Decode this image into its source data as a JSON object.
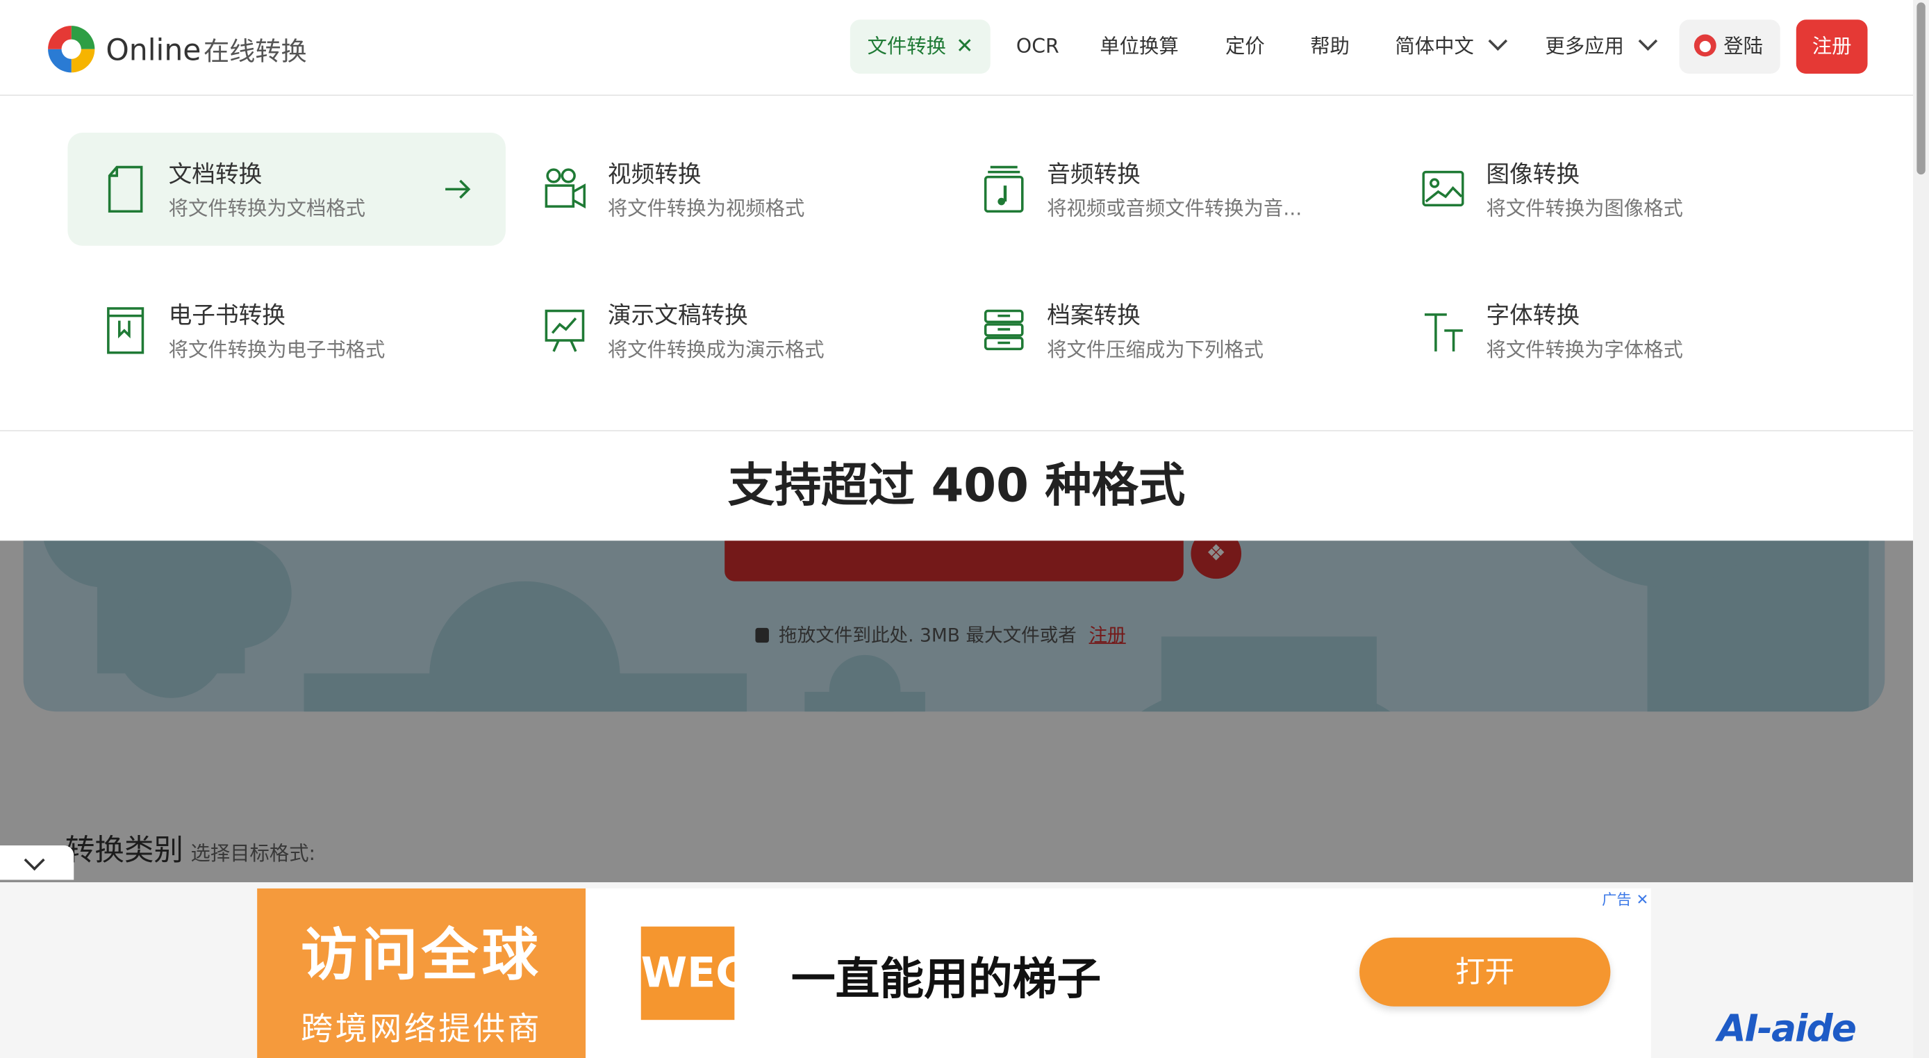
{
  "header": {
    "brand": "Online",
    "brand_cn": "在线转换",
    "nav": {
      "file_convert": "文件转换",
      "ocr": "OCR",
      "unit": "单位换算",
      "pricing": "定价",
      "help": "帮助",
      "language": "简体中文",
      "more_apps": "更多应用",
      "login": "登陆",
      "signup": "注册"
    }
  },
  "menu": {
    "cards": [
      {
        "title": "文档转换",
        "desc": "将文件转换为文档格式"
      },
      {
        "title": "视频转换",
        "desc": "将文件转换为视频格式"
      },
      {
        "title": "音频转换",
        "desc": "将视频或音频文件转换为音..."
      },
      {
        "title": "图像转换",
        "desc": "将文件转换为图像格式"
      },
      {
        "title": "电子书转换",
        "desc": "将文件转换为电子书格式"
      },
      {
        "title": "演示文稿转换",
        "desc": "将文件转换成为演示格式"
      },
      {
        "title": "档案转换",
        "desc": "将文件压缩成为下列格式"
      },
      {
        "title": "字体转换",
        "desc": "将文件转换为字体格式"
      }
    ]
  },
  "formats_banner": "支持超过 400 种格式",
  "upload": {
    "note": "拖放文件到此处. 3MB 最大文件或者",
    "register": "注册"
  },
  "category": {
    "heading": "转换类别",
    "sub": "选择目标格式:"
  },
  "ad": {
    "left_line1": "访问全球",
    "left_line2": "跨境网络提供商",
    "logo": "WEG",
    "title": "一直能用的梯子",
    "button": "打开",
    "label": "广告",
    "close": "✕"
  },
  "watermark": "AI-aide",
  "colors": {
    "accent_green": "#1f7a35",
    "brand_red": "#e53935",
    "ad_orange": "#f5962f"
  }
}
